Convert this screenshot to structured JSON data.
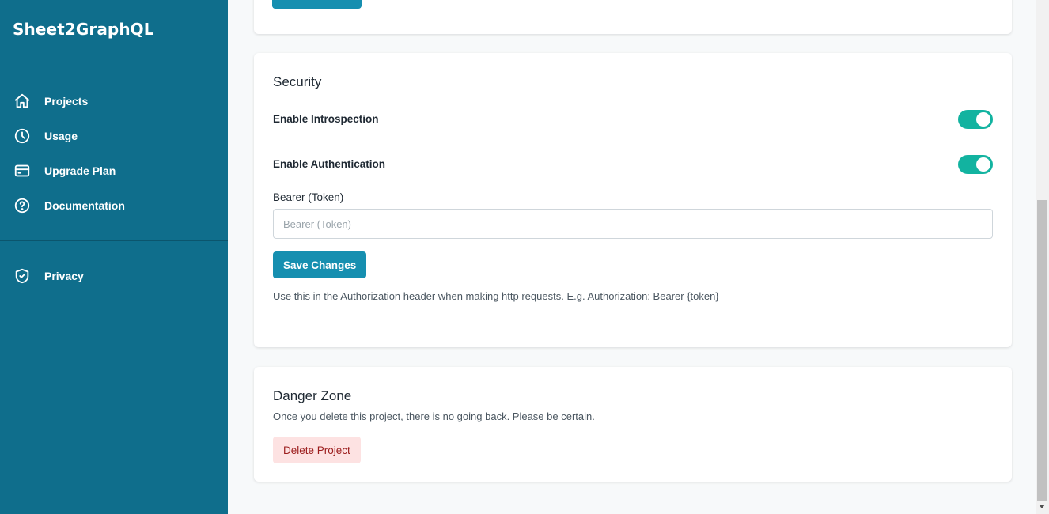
{
  "app": {
    "brand": "Sheet2GraphQL"
  },
  "sidebar": {
    "items": [
      {
        "label": "Projects",
        "icon": "home-icon"
      },
      {
        "label": "Usage",
        "icon": "clock-icon"
      },
      {
        "label": "Upgrade Plan",
        "icon": "credit-card-icon"
      },
      {
        "label": "Documentation",
        "icon": "help-circle-icon"
      },
      {
        "label": "Privacy",
        "icon": "shield-check-icon"
      }
    ]
  },
  "security": {
    "title": "Security",
    "introspection_label": "Enable Introspection",
    "introspection_enabled": true,
    "authentication_label": "Enable Authentication",
    "authentication_enabled": true,
    "token_label": "Bearer (Token)",
    "token_placeholder": "Bearer (Token)",
    "token_value": "",
    "save_label": "Save Changes",
    "help_text": "Use this in the Authorization header when making http requests. E.g. Authorization: Bearer {token}"
  },
  "danger": {
    "title": "Danger Zone",
    "description": "Once you delete this project, there is no going back. Please be certain.",
    "delete_label": "Delete Project"
  },
  "colors": {
    "sidebar_bg": "#0f6e8c",
    "primary": "#168fb0",
    "toggle_on": "#12b3a0",
    "danger_bg": "#fde2e2",
    "danger_text": "#9b1c1c"
  }
}
